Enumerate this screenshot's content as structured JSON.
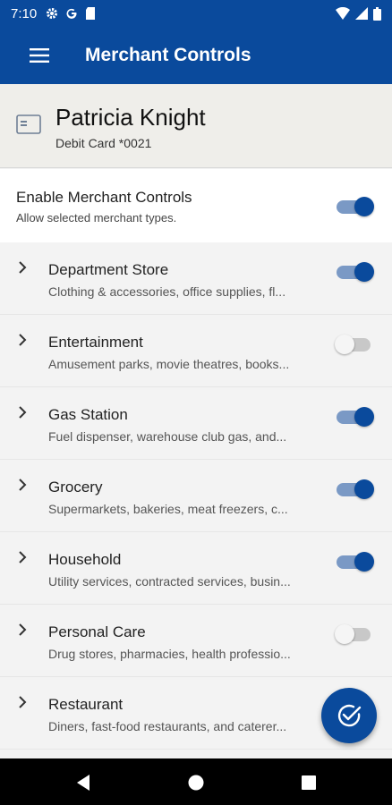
{
  "status_bar": {
    "time": "7:10",
    "left_icons": [
      "gear-icon",
      "google-icon",
      "sd-card-icon"
    ],
    "right_icons": [
      "wifi-icon",
      "signal-icon",
      "battery-icon"
    ]
  },
  "app_bar": {
    "title": "Merchant Controls",
    "menu_icon": "hamburger-menu-icon"
  },
  "account": {
    "name": "Patricia Knight",
    "card": "Debit Card *0021"
  },
  "enable": {
    "title": "Enable Merchant Controls",
    "subtitle": "Allow selected merchant types.",
    "enabled": true
  },
  "merchants": [
    {
      "title": "Department Store",
      "subtitle": "Clothing & accessories, office supplies, fl...",
      "enabled": true
    },
    {
      "title": "Entertainment",
      "subtitle": "Amusement parks, movie theatres, books...",
      "enabled": false
    },
    {
      "title": "Gas Station",
      "subtitle": "Fuel dispenser, warehouse club gas, and...",
      "enabled": true
    },
    {
      "title": "Grocery",
      "subtitle": "Supermarkets, bakeries, meat freezers, c...",
      "enabled": true
    },
    {
      "title": "Household",
      "subtitle": "Utility services, contracted services, busin...",
      "enabled": true
    },
    {
      "title": "Personal Care",
      "subtitle": "Drug stores, pharmacies, health professio...",
      "enabled": false
    },
    {
      "title": "Restaurant",
      "subtitle": "Diners, fast-food restaurants, and caterer...",
      "enabled": false
    }
  ],
  "fab_icon": "check-circle-icon",
  "colors": {
    "primary": "#0a4a9c",
    "toggle_track_on": "#7a99c5",
    "header_bg": "#efeeea"
  }
}
